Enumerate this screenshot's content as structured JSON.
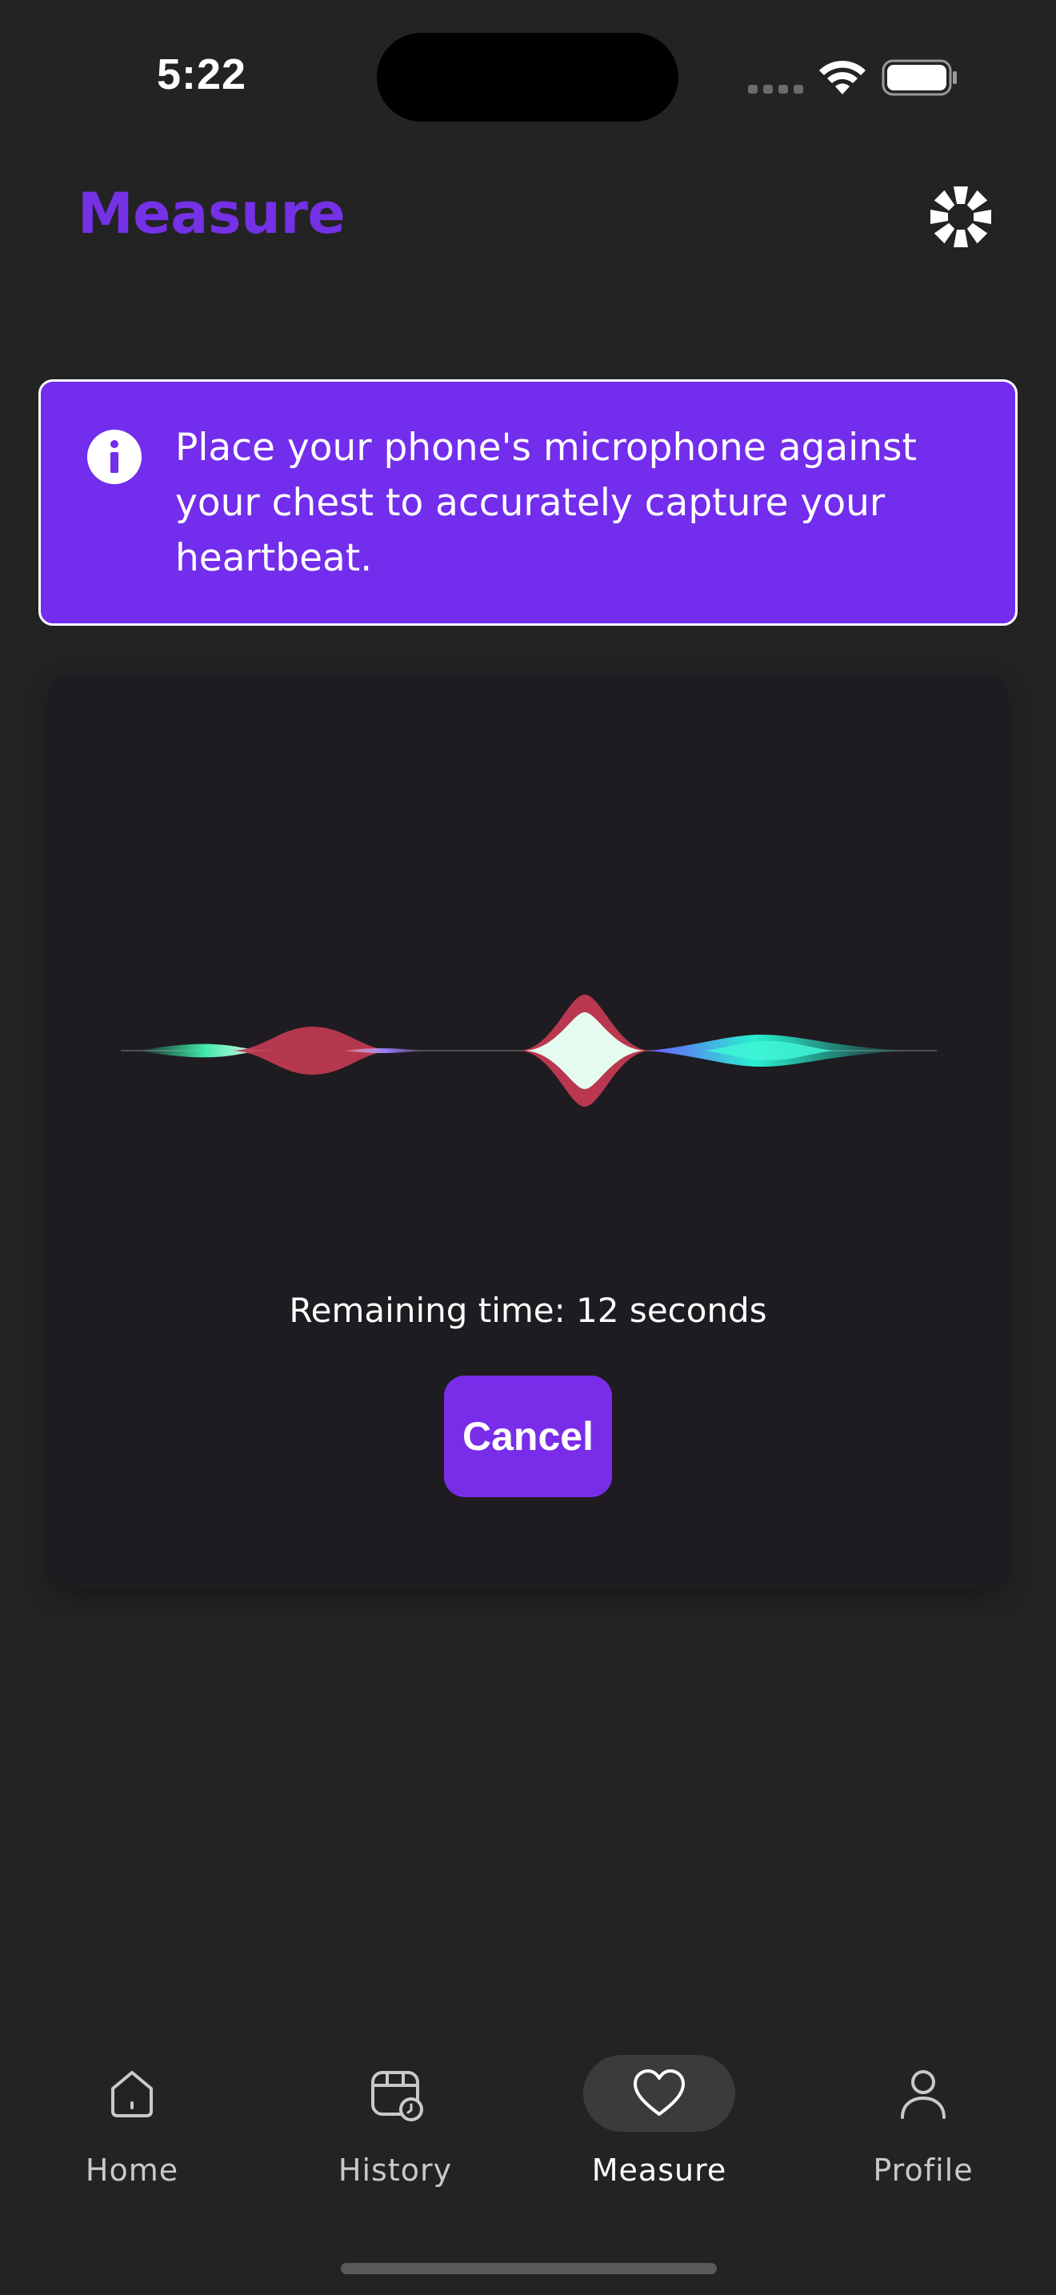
{
  "status_bar": {
    "time": "5:22",
    "signal_icon": "cellular-signal-icon",
    "wifi_icon": "wifi-icon",
    "battery_icon": "battery-icon"
  },
  "header": {
    "title": "Measure",
    "action_icon": "loading-spinner-icon"
  },
  "info_banner": {
    "icon": "info-icon",
    "text": "Place your phone's microphone against your chest to accurately capture your heartbeat."
  },
  "measurement": {
    "waveform": "audio-waveform",
    "remaining_text": "Remaining time: 12 seconds",
    "cancel_label": "Cancel"
  },
  "bottom_nav": {
    "items": [
      {
        "label": "Home",
        "icon": "home-icon",
        "active": false
      },
      {
        "label": "History",
        "icon": "calendar-clock-icon",
        "active": false
      },
      {
        "label": "Measure",
        "icon": "heart-icon",
        "active": true
      },
      {
        "label": "Profile",
        "icon": "user-icon",
        "active": false
      }
    ]
  },
  "colors": {
    "background": "#232323",
    "accent": "#732ded",
    "title": "#7431e6",
    "card": "#1e1c21"
  }
}
